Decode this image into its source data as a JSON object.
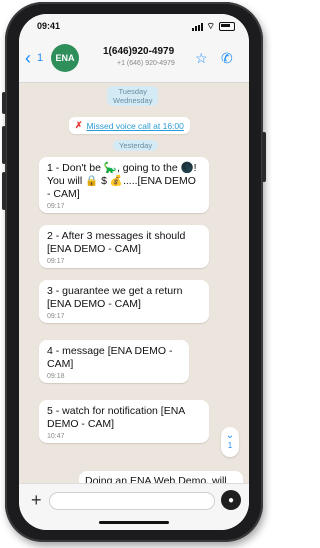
{
  "status": {
    "time": "09:41"
  },
  "header": {
    "back_label": "1",
    "avatar_text": "ENA",
    "contact_name": "1(646)920-4979",
    "contact_sub": "+1 (646) 920-4979",
    "star_icon": "star-icon",
    "phone_icon": "phone-icon"
  },
  "chat": {
    "date_1_line1": "Tuesday",
    "date_1_line2": "Wednesday",
    "missed_call": "Missed voice call at 16:00",
    "date_2": "Yesterday",
    "messages": [
      {
        "text": "1 - Don't be 🦕, going to the 🌑! You will 🔒 $ 💰.....[ENA DEMO - CAM]",
        "time": "09:17"
      },
      {
        "text": "2 - After 3 messages it should [ENA DEMO - CAM]",
        "time": "09:17"
      },
      {
        "text": "3 - guarantee we get a return [ENA DEMO - CAM]",
        "time": "09:17"
      },
      {
        "text": "4 - message [ENA DEMO -CAM]",
        "time": "09:18"
      },
      {
        "text": "5 - watch for notification [ENA DEMO - CAM]",
        "time": "10:47"
      }
    ],
    "scroll_badge_count": "1",
    "outgoing_text": "Doing an ENA Web Demo, will"
  },
  "input": {
    "plus_icon": "plus-icon",
    "mic_icon": "mic-icon"
  }
}
